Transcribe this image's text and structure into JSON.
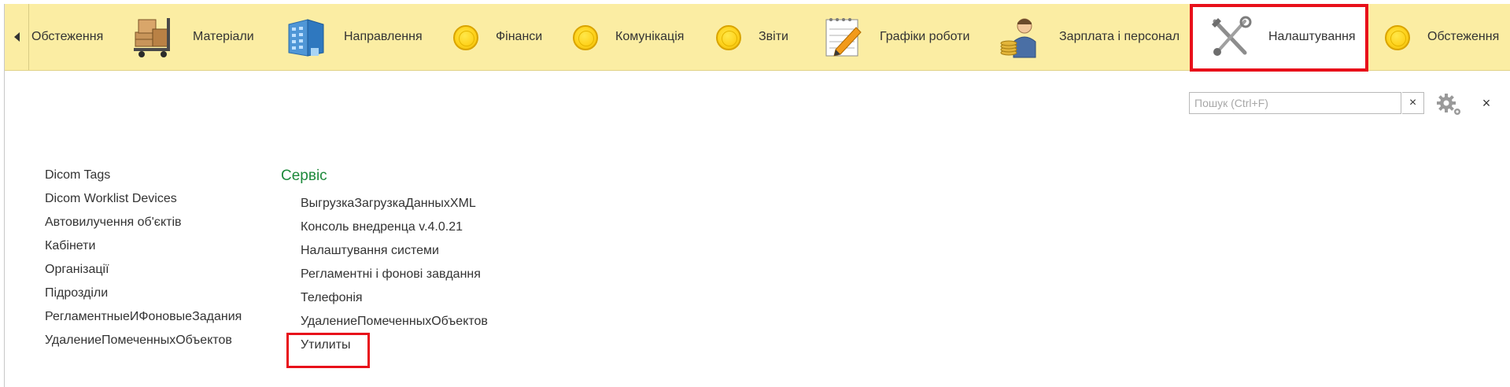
{
  "sections_bar": {
    "items": [
      {
        "label": "Обстеження",
        "icon": "none"
      },
      {
        "label": "Матеріали",
        "icon": "boxes-cart-icon"
      },
      {
        "label": "Направлення",
        "icon": "building-icon"
      },
      {
        "label": "Фінанси",
        "icon": "coin-icon"
      },
      {
        "label": "Комунікація",
        "icon": "coin-icon"
      },
      {
        "label": "Звіти",
        "icon": "coin-icon"
      },
      {
        "label": "Графіки роботи",
        "icon": "notepad-pencil-icon"
      },
      {
        "label": "Зарплата і персонал",
        "icon": "worker-coins-icon"
      },
      {
        "label": "Налаштування",
        "icon": "tools-icon",
        "active": true
      },
      {
        "label": "Обстеження",
        "icon": "coin-icon"
      }
    ]
  },
  "search": {
    "placeholder": "Пошук (Ctrl+F)",
    "value": "",
    "clear_label": "×"
  },
  "panel": {
    "close_label": "×"
  },
  "left_list": [
    "Dicom Tags",
    "Dicom Worklist Devices",
    "Автовилучення об'єктів",
    "Кабінети",
    "Організації",
    "Підрозділи",
    "РегламентныеИФоновыеЗадания",
    "УдалениеПомеченныхОбъектов"
  ],
  "service": {
    "title": "Сервіс",
    "items": [
      "ВыгрузкаЗагрузкаДанныхXML",
      "Консоль внедренца v.4.0.21",
      "Налаштування системи",
      "Регламентні і фонові завдання",
      "Телефонія",
      "УдалениеПомеченныхОбъектов",
      "Утилиты"
    ]
  },
  "colors": {
    "bar_background": "#fbeda3",
    "highlight": "#e8101a",
    "group_title": "#1e8a3c"
  }
}
